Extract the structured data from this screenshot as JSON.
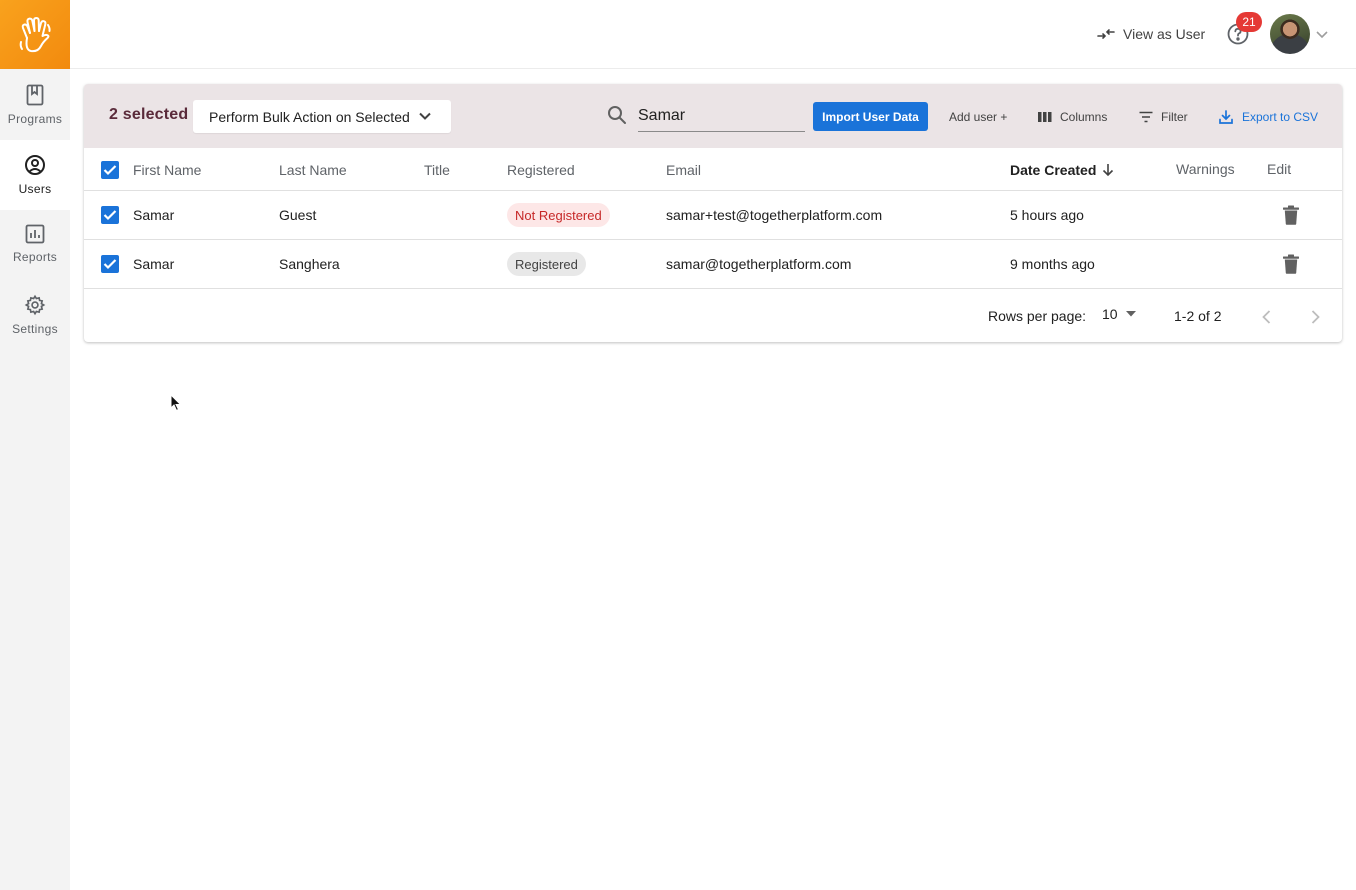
{
  "sidebar": {
    "items": [
      {
        "label": "Programs",
        "icon": "book-icon",
        "active": false
      },
      {
        "label": "Users",
        "icon": "user-circle-icon",
        "active": true
      },
      {
        "label": "Reports",
        "icon": "bar-chart-icon",
        "active": false
      },
      {
        "label": "Settings",
        "icon": "gear-icon",
        "active": false
      }
    ]
  },
  "header": {
    "view_as_user": "View as User",
    "help_badge": "21"
  },
  "toolbar": {
    "selected_count": "2 selected",
    "bulk_action": "Perform Bulk Action on Selected",
    "search_value": "Samar",
    "import_label": "Import User Data",
    "add_user_label": "Add user +",
    "columns_label": "Columns",
    "filter_label": "Filter",
    "export_label": "Export to CSV"
  },
  "table": {
    "columns": [
      "First Name",
      "Last Name",
      "Title",
      "Registered",
      "Email",
      "Date Created",
      "Warnings",
      "Edit"
    ],
    "rows": [
      {
        "first": "Samar",
        "last": "Guest",
        "title": "",
        "registered": "Not Registered",
        "email": "samar+test@togetherplatform.com",
        "created": "5 hours ago",
        "warnings": ""
      },
      {
        "first": "Samar",
        "last": "Sanghera",
        "title": "",
        "registered": "Registered",
        "email": "samar@togetherplatform.com",
        "created": "9 months ago",
        "warnings": ""
      }
    ]
  },
  "pagination": {
    "rows_per_page_label": "Rows per page:",
    "rows_per_page": "10",
    "range": "1-2 of 2"
  },
  "colors": {
    "accent": "#1a73d9",
    "brand": "#f7941d",
    "toolbar_bg": "#ebe4e6",
    "not_registered": "#c62828"
  }
}
